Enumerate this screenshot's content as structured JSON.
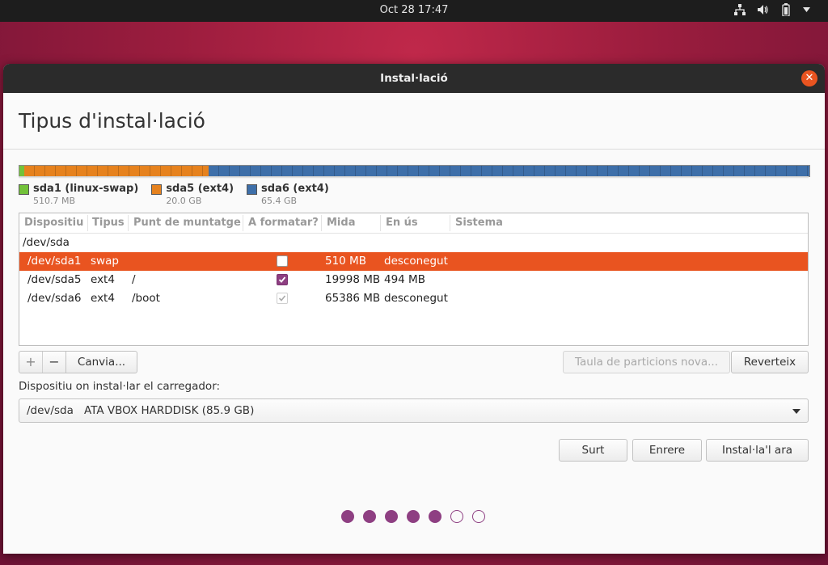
{
  "topbar": {
    "datetime": "Oct 28  17:47"
  },
  "window": {
    "title": "Instal·lació"
  },
  "page": {
    "title": "Tipus d'instal·lació"
  },
  "partition_bar": {
    "segments": [
      {
        "name": "sda1 (linux-swap)",
        "size": "510.7 MB",
        "color": "#73c23a",
        "fraction": 0.006
      },
      {
        "name": "sda5 (ext4)",
        "size": "20.0 GB",
        "color": "#e6821e",
        "fraction": 0.233
      },
      {
        "name": "sda6 (ext4)",
        "size": "65.4 GB",
        "color": "#3e6fa9",
        "fraction": 0.761
      }
    ]
  },
  "table": {
    "headers": [
      "Dispositiu",
      "Tipus",
      "Punt de muntatge",
      "A formatar?",
      "Mida",
      "En ús",
      "Sistema"
    ],
    "disk": "/dev/sda",
    "rows": [
      {
        "device": "/dev/sda1",
        "type": "swap",
        "mount": "",
        "format": "unchecked",
        "size": "510 MB",
        "used": "desconegut",
        "system": "",
        "selected": true
      },
      {
        "device": "/dev/sda5",
        "type": "ext4",
        "mount": "/",
        "format": "checked",
        "size": "19998 MB",
        "used": "494 MB",
        "system": "",
        "selected": false
      },
      {
        "device": "/dev/sda6",
        "type": "ext4",
        "mount": "/boot",
        "format": "checked-disabled",
        "size": "65386 MB",
        "used": "desconegut",
        "system": "",
        "selected": false
      }
    ]
  },
  "toolbar": {
    "add": "+",
    "remove": "−",
    "change": "Canvia...",
    "new_table": "Taula de particions nova...",
    "revert": "Reverteix"
  },
  "bootloader": {
    "label": "Dispositiu on instal·lar el carregador:",
    "device": "/dev/sda",
    "description": "ATA VBOX HARDDISK (85.9 GB)"
  },
  "actions": {
    "quit": "Surt",
    "back": "Enrere",
    "install": "Instal·la'l ara"
  },
  "progress": {
    "completed_steps": 5,
    "total_steps": 7
  }
}
